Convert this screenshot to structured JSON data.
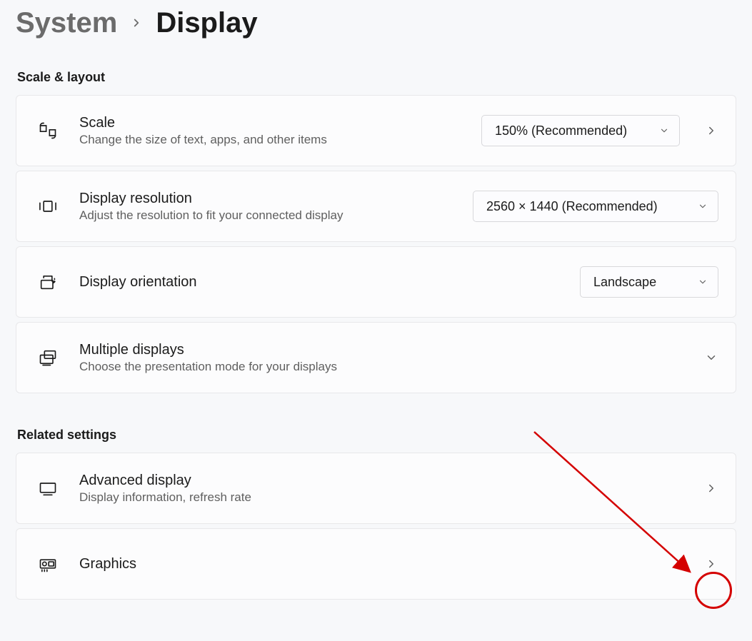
{
  "breadcrumb": {
    "parent": "System",
    "current": "Display"
  },
  "sections": {
    "scale_layout": "Scale & layout",
    "related": "Related settings"
  },
  "rows": {
    "scale": {
      "title": "Scale",
      "subtitle": "Change the size of text, apps, and other items",
      "value": "150% (Recommended)"
    },
    "resolution": {
      "title": "Display resolution",
      "subtitle": "Adjust the resolution to fit your connected display",
      "value": "2560 × 1440 (Recommended)"
    },
    "orientation": {
      "title": "Display orientation",
      "value": "Landscape"
    },
    "multiple": {
      "title": "Multiple displays",
      "subtitle": "Choose the presentation mode for your displays"
    },
    "advanced": {
      "title": "Advanced display",
      "subtitle": "Display information, refresh rate"
    },
    "graphics": {
      "title": "Graphics"
    }
  }
}
